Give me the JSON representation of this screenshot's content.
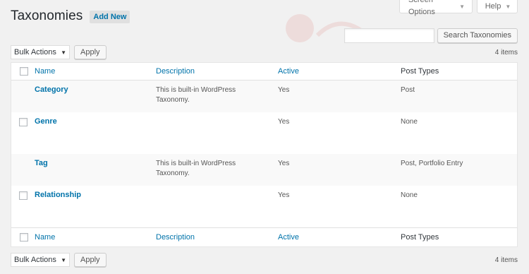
{
  "screen_meta": {
    "screen_options_label": "Screen Options",
    "help_label": "Help",
    "caret": "▼"
  },
  "page": {
    "title": "Taxonomies",
    "add_new_label": "Add New"
  },
  "search": {
    "placeholder": "",
    "button_label": "Search Taxonomies"
  },
  "tablenav_top": {
    "bulk_actions": "Bulk Actions",
    "apply_label": "Apply",
    "count": "4 items"
  },
  "tablenav_bottom": {
    "bulk_actions": "Bulk Actions",
    "apply_label": "Apply",
    "count": "4 items"
  },
  "table": {
    "columns": [
      "Name",
      "Description",
      "Active",
      "Post Types"
    ],
    "rows": [
      {
        "name": "Category",
        "description": "This is built-in WordPress Taxonomy.",
        "active": "Yes",
        "post_types": "Post",
        "has_checkbox": false
      },
      {
        "name": "Genre",
        "description": "",
        "active": "Yes",
        "post_types": "None",
        "has_checkbox": true
      },
      {
        "name": "Tag",
        "description": "This is built-in WordPress Taxonomy.",
        "active": "Yes",
        "post_types": "Post, Portfolio Entry",
        "has_checkbox": false
      },
      {
        "name": "Relationship",
        "description": "",
        "active": "Yes",
        "post_types": "None",
        "has_checkbox": true
      }
    ]
  },
  "colors": {
    "link": "#0073aa",
    "background": "#f1f1f1",
    "watermark": "#d9534f"
  }
}
